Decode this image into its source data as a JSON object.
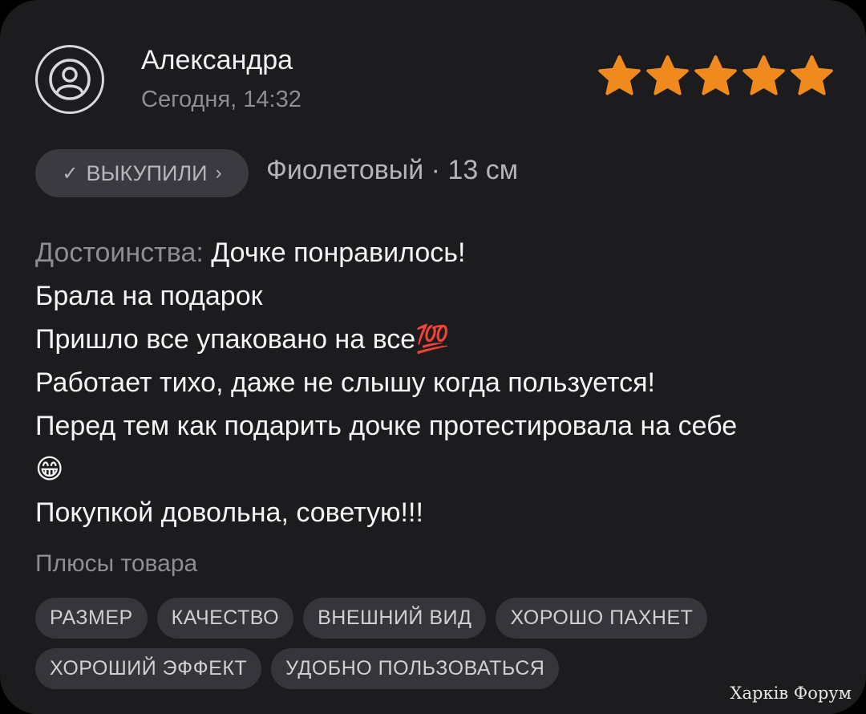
{
  "review": {
    "author": "Александра",
    "date": "Сегодня, 14:32",
    "rating": 5,
    "rating_max": 5,
    "star_color": "#f08a1e",
    "buyer_badge": {
      "check_icon": "check-icon",
      "label": "ВЫКУПИЛИ",
      "chevron_icon": "chevron-right-icon"
    },
    "variant": "Фиолетовый · 13 см",
    "advantages_label": "Достоинства:",
    "text_lines": [
      "Дочке понравилось!",
      "Брала на подарок",
      "Пришло все упаковано на все💯",
      "Работает тихо, даже не слышу когда пользуется!",
      "Перед тем как подарить дочке протестировала на себе",
      "😁",
      "Покупкой довольна, советую!!!"
    ],
    "pros_heading": "Плюсы товара",
    "pros_tags": [
      "РАЗМЕР",
      "КАЧЕСТВО",
      "ВНЕШНИЙ ВИД",
      "ХОРОШО ПАХНЕТ",
      "ХОРОШИЙ ЭФФЕКТ",
      "УДОБНО ПОЛЬЗОВАТЬСЯ"
    ]
  },
  "watermark": "Харків Форум"
}
